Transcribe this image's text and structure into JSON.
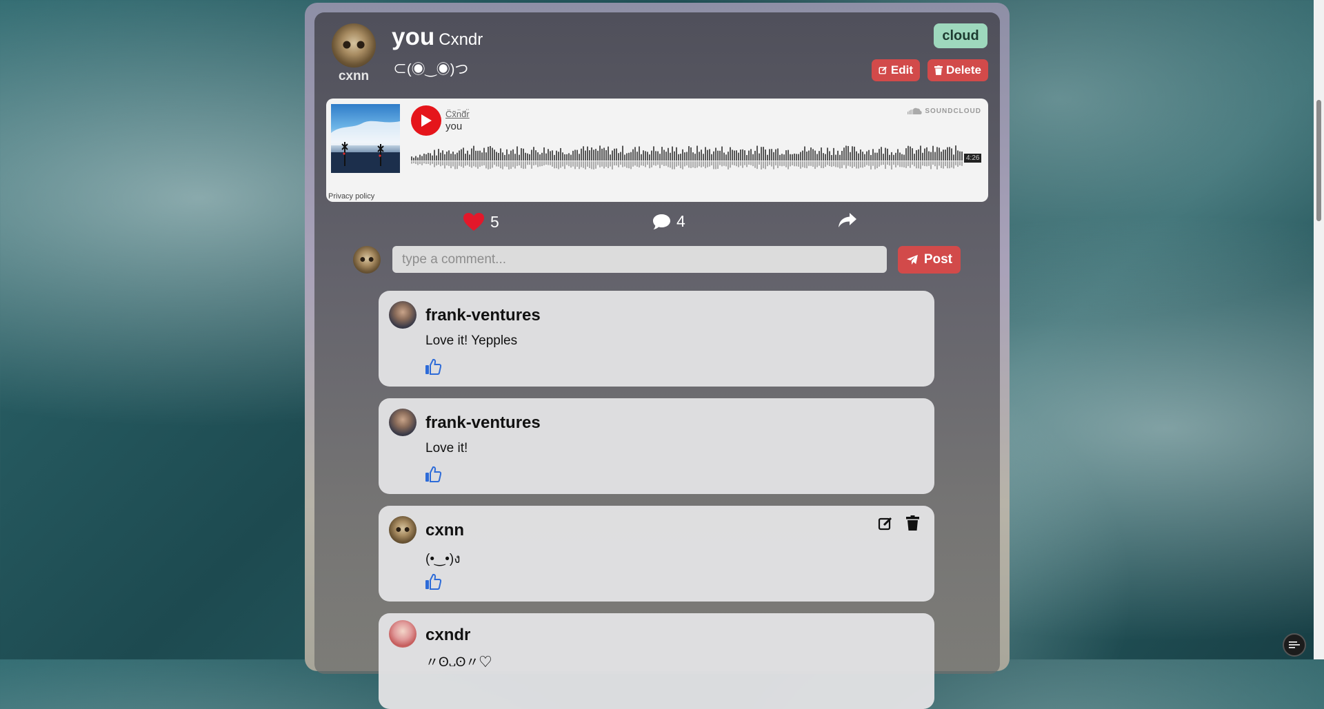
{
  "post": {
    "owner": "cxnn",
    "title": "you",
    "artist": "Cxndr",
    "caption": "⊂(◉‿◉)つ",
    "tag": "cloud",
    "edit_label": "Edit",
    "delete_label": "Delete"
  },
  "player": {
    "artist": "C̈x̃n̈d̃r̈",
    "track": "you",
    "brand": "SOUNDCLOUD",
    "duration": "4:26",
    "privacy": "Privacy policy"
  },
  "stats": {
    "likes": "5",
    "comments": "4"
  },
  "composer": {
    "placeholder": "type a comment...",
    "post_label": "Post"
  },
  "comments": [
    {
      "author": "frank-ventures",
      "text": "Love it! Yepples"
    },
    {
      "author": "frank-ventures",
      "text": "Love it!"
    },
    {
      "author": "cxnn",
      "text": "(•‿•)ง"
    },
    {
      "author": "cxndr",
      "text": "〃ʘ᎑ʘ〃♡"
    }
  ],
  "colors": {
    "accent_red": "#d24a4a",
    "tag_green": "#9ed8bd",
    "like_blue": "#2d6bd8",
    "heart_red": "#e3182a"
  },
  "icons": [
    "edit-icon",
    "trash-icon",
    "play-icon",
    "soundcloud-icon",
    "heart-icon",
    "comment-icon",
    "share-icon",
    "send-icon",
    "thumbs-up-icon",
    "menu-icon"
  ]
}
